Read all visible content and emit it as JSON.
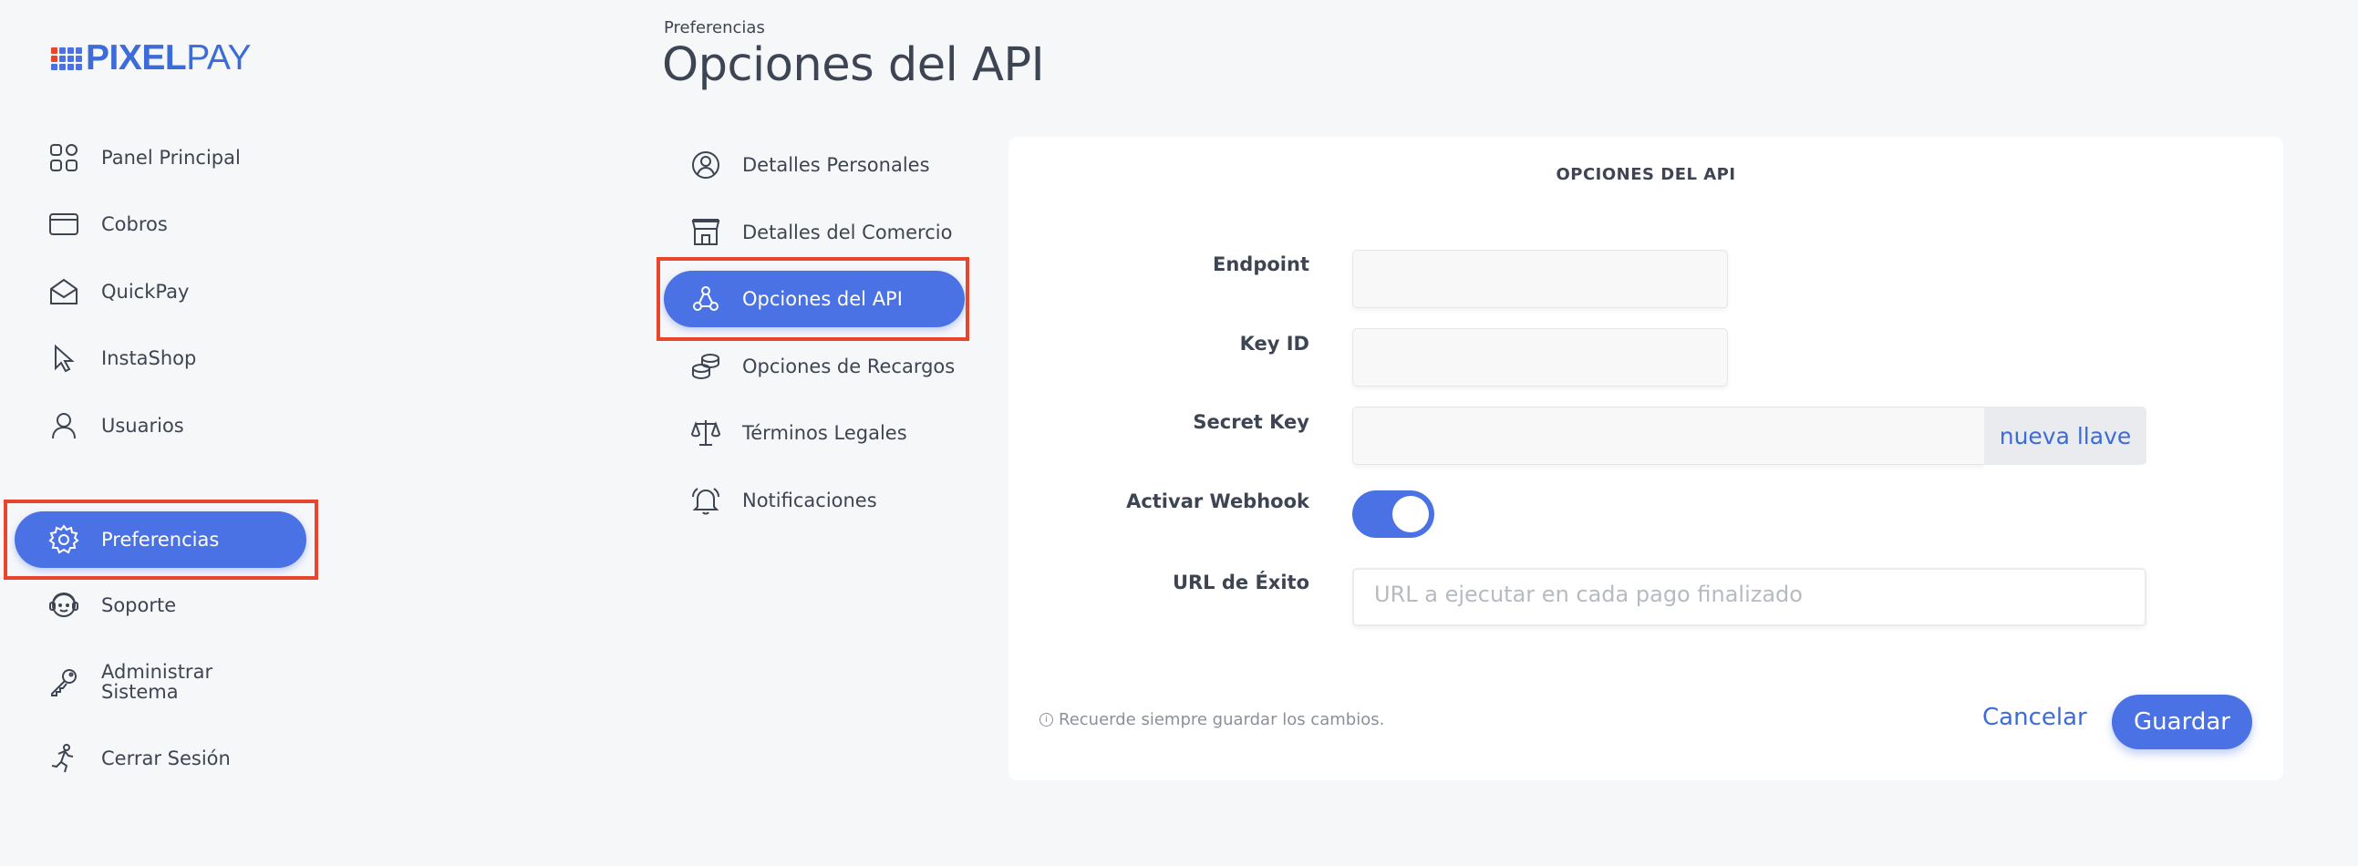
{
  "brand": {
    "logo_primary": "PIXEL",
    "logo_secondary": "PAY",
    "primary_color": "#4a72e4",
    "text_color": "#3d4553",
    "logo_color_primary": "#3d6bd8",
    "logo_color_secondary": "#3d6bd8",
    "highlight_color": "#e8452c",
    "logo_dot_colors": [
      "#e8452c",
      "#4a72e4",
      "#4a72e4",
      "#4a72e4",
      "#e8452c",
      "#4a72e4",
      "#4a72e4",
      "#4a72e4",
      "#4a72e4",
      "#4a72e4",
      "#4a72e4",
      "#4a72e4"
    ]
  },
  "sidebar": {
    "items": [
      {
        "label": "Panel Principal",
        "icon": "dashboard-icon"
      },
      {
        "label": "Cobros",
        "icon": "card-icon"
      },
      {
        "label": "QuickPay",
        "icon": "envelope-icon"
      },
      {
        "label": "InstaShop",
        "icon": "cursor-icon"
      },
      {
        "label": "Usuarios",
        "icon": "user-icon"
      },
      {
        "label": "Preferencias",
        "icon": "gear-icon",
        "active": true
      },
      {
        "label": "Soporte",
        "icon": "support-icon"
      },
      {
        "label_line1": "Administrar",
        "label_line2": "Sistema",
        "icon": "key-icon"
      },
      {
        "label": "Cerrar Sesión",
        "icon": "run-icon"
      }
    ]
  },
  "header": {
    "breadcrumb": "Preferencias",
    "title": "Opciones del API"
  },
  "subnav": {
    "items": [
      {
        "label": "Detalles Personales",
        "icon": "user-circle-icon"
      },
      {
        "label": "Detalles del Comercio",
        "icon": "store-icon"
      },
      {
        "label": "Opciones del API",
        "icon": "webhook-icon",
        "active": true
      },
      {
        "label": "Opciones de Recargos",
        "icon": "coins-icon"
      },
      {
        "label": "Términos Legales",
        "icon": "scale-icon"
      },
      {
        "label": "Notificaciones",
        "icon": "bell-icon"
      }
    ]
  },
  "form": {
    "title": "OPCIONES DEL API",
    "endpoint_label": "Endpoint",
    "endpoint_value": "",
    "key_id_label": "Key ID",
    "key_id_value": "",
    "secret_key_label": "Secret Key",
    "secret_key_value": "",
    "new_key_button": "nueva llave",
    "webhook_label": "Activar Webhook",
    "webhook_enabled": true,
    "success_url_label": "URL de Éxito",
    "success_url_placeholder": "URL a ejecutar en cada pago finalizado",
    "hint": "Recuerde siempre guardar los cambios.",
    "cancel_label": "Cancelar",
    "save_label": "Guardar"
  }
}
